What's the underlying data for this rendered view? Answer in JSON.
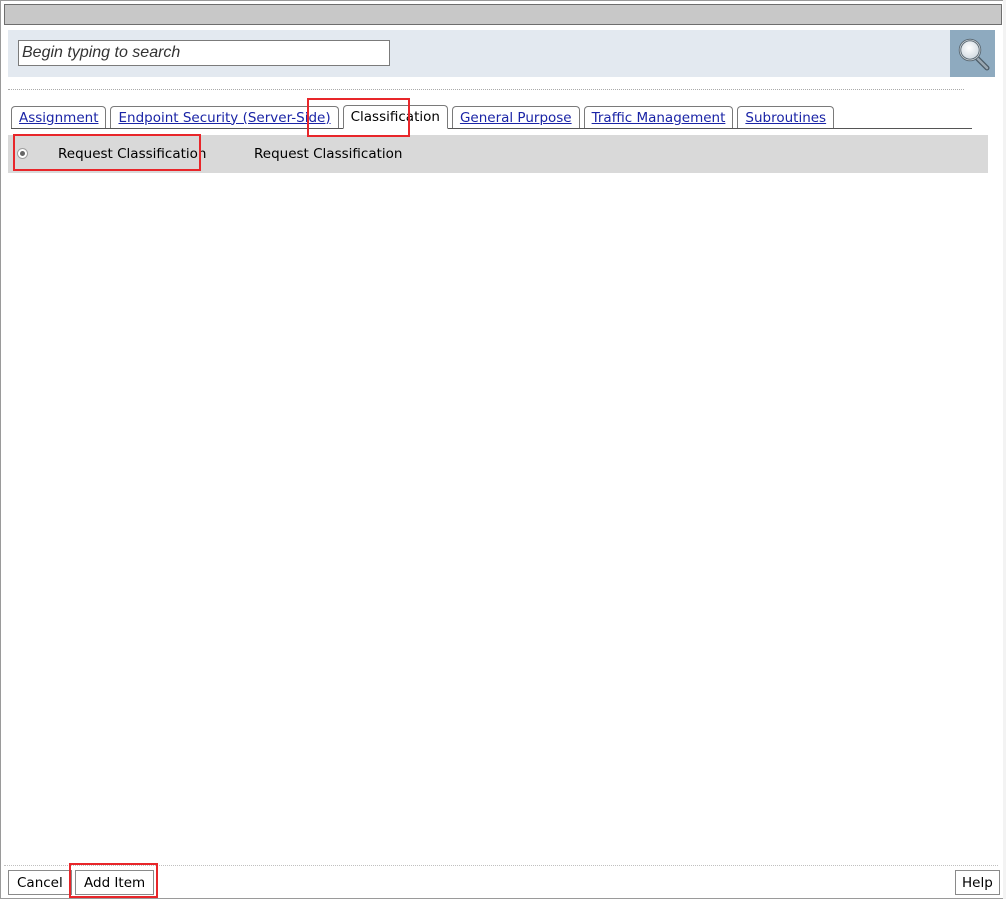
{
  "search": {
    "placeholder": "Begin typing to search",
    "button_icon": "magnifier-icon"
  },
  "tabs": [
    {
      "label": "Assignment",
      "active": false
    },
    {
      "label": "Endpoint Security (Server-Side)",
      "active": false
    },
    {
      "label": "Classification",
      "active": true
    },
    {
      "label": "General Purpose",
      "active": false
    },
    {
      "label": "Traffic Management",
      "active": false
    },
    {
      "label": "Subroutines",
      "active": false
    }
  ],
  "items": [
    {
      "name": "Request Classification",
      "description": "Request Classification",
      "selected": true
    }
  ],
  "footer": {
    "cancel_label": "Cancel",
    "add_item_label": "Add Item",
    "help_label": "Help"
  },
  "colors": {
    "search_bar_bg": "#e3e9f0",
    "search_button_bg": "#8eaabf",
    "link": "#1a24a6",
    "row_bg": "#d9d9d9",
    "highlight": "#e8262a"
  }
}
